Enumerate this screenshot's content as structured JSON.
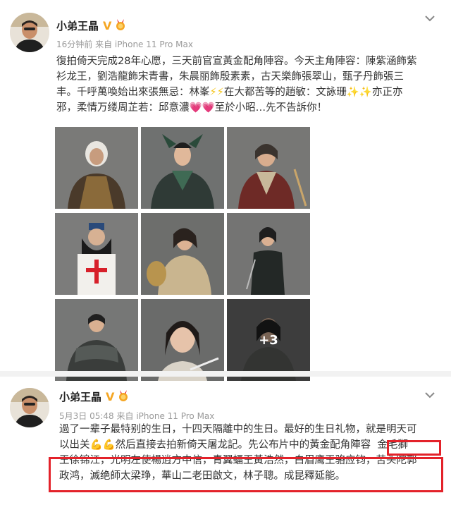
{
  "post1": {
    "username": "小弟王晶",
    "verified_badge": "V",
    "time": "16分钟前",
    "source": "来自 iPhone 11 Pro Max",
    "text_lines": [
      "復拍倚天完成28年心愿，三天前官宣黃金配角陣容。今天主角陣容：陳紫涵飾紫",
      "衫龙王，劉浩龍飾宋青書，朱晨丽飾殷素素，古天樂飾張翠山，甄子丹飾張三",
      "丰。千呼萬喚始出來張無忌：林峯",
      "在大都苦等的趙敏：文詠珊",
      "亦正亦",
      "邪，柔情万缕周芷若：邱意濃",
      "至於小昭…先不告訴你！"
    ],
    "emoji_lightning": "⚡⚡",
    "emoji_sparkles": "✨✨",
    "emoji_hearts": "💗💗",
    "more_photos": "+3",
    "accent_color": "#f5a623"
  },
  "post2": {
    "username": "小弟王晶",
    "verified_badge": "V",
    "time": "5月3日 05:48",
    "source": "来自 iPhone 11 Pro Max",
    "line1": "過了一辈子最特别的生日，十四天隔離中的生日。最好的生日礼物，就是明天可",
    "line2_a": "以出关",
    "emoji_muscle": "💪💪",
    "line2_b": "然后直接去拍新倚天屠龙記。先公布片中的黃金配角陣容",
    "highlight_name": "金毛獅",
    "line3": "王徐锦江，光明左使楊逍方中信，青翼蝠王黃浩然，白眉鹰王骆应钧，苦头陀郭",
    "line4": "政鸿，滅绝師太梁琤，華山二老田啟文，林子聰。成昆釋延能。",
    "highlight_color": "#e3222a"
  }
}
